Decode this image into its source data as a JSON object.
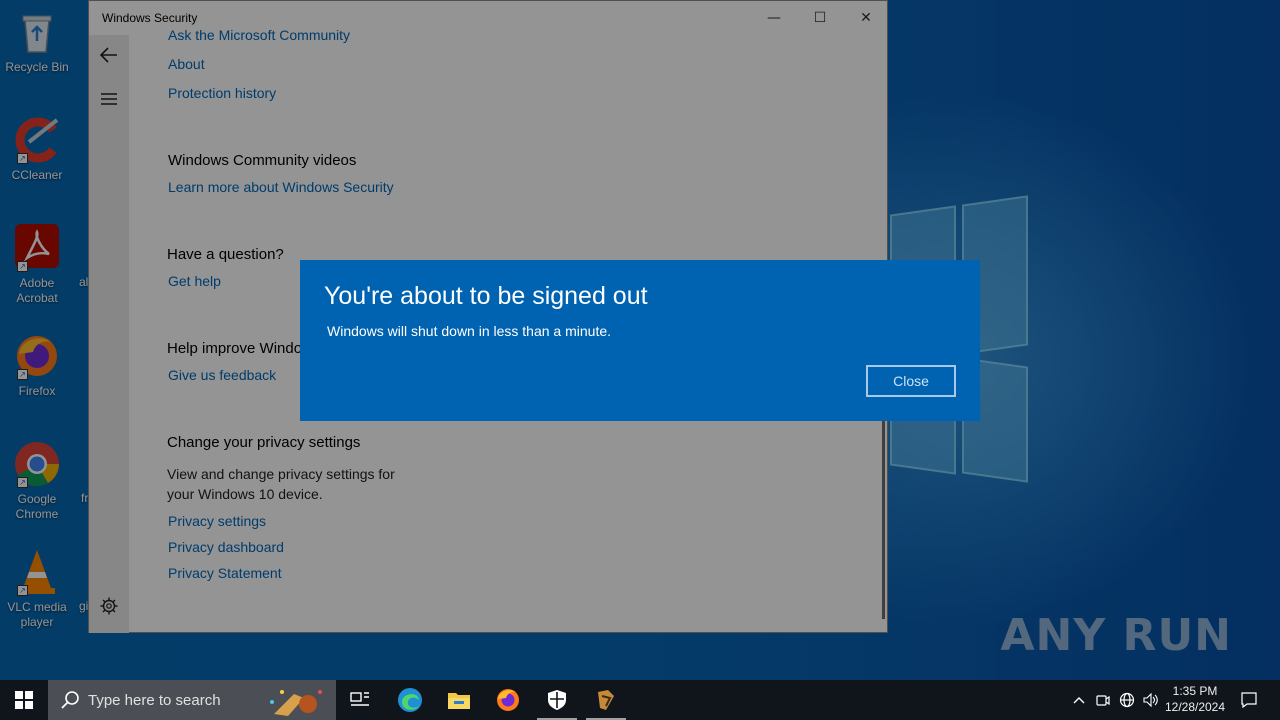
{
  "desktop": {
    "icons": [
      {
        "label": "Recycle Bin",
        "icon": "recycle-bin-icon"
      },
      {
        "label": "CCleaner",
        "icon": "ccleaner-icon"
      },
      {
        "label": "Adobe Acrobat",
        "icon": "adobe-acrobat-icon"
      },
      {
        "label": "Firefox",
        "icon": "firefox-icon"
      },
      {
        "label": "Google Chrome",
        "icon": "chrome-icon"
      },
      {
        "label": "VLC media player",
        "icon": "vlc-icon"
      }
    ],
    "partial_labels": [
      "al",
      "fr",
      "gi"
    ],
    "watermark": "ANY RUN"
  },
  "window": {
    "title": "Windows Security",
    "controls": {
      "minimize": "—",
      "maximize": "☐",
      "close": "✕"
    },
    "links_top": [
      "Ask the Microsoft Community",
      "About",
      "Protection history"
    ],
    "sections": [
      {
        "heading": "Windows Community videos",
        "links": [
          "Learn more about Windows Security"
        ]
      },
      {
        "heading": "Have a question?",
        "links": [
          "Get help"
        ]
      },
      {
        "heading": "Help improve Windows Security",
        "links": [
          "Give us feedback"
        ]
      },
      {
        "heading": "Change your privacy settings",
        "text": "View and change privacy settings for your Windows 10 device.",
        "links": [
          "Privacy settings",
          "Privacy dashboard",
          "Privacy Statement"
        ]
      }
    ]
  },
  "dialog": {
    "title": "You're about to be signed out",
    "message": "Windows will shut down in less than a minute.",
    "close_label": "Close"
  },
  "taskbar": {
    "search_placeholder": "Type here to search",
    "time": "1:35 PM",
    "date": "12/28/2024",
    "apps": [
      "task-view-icon",
      "edge-icon",
      "file-explorer-icon",
      "firefox-icon",
      "windows-security-icon",
      "app-icon"
    ]
  },
  "colors": {
    "dialog_bg": "#0063b1",
    "link": "#0067b8",
    "taskbar": "#10151c",
    "wallpaper": "#0768b4"
  }
}
